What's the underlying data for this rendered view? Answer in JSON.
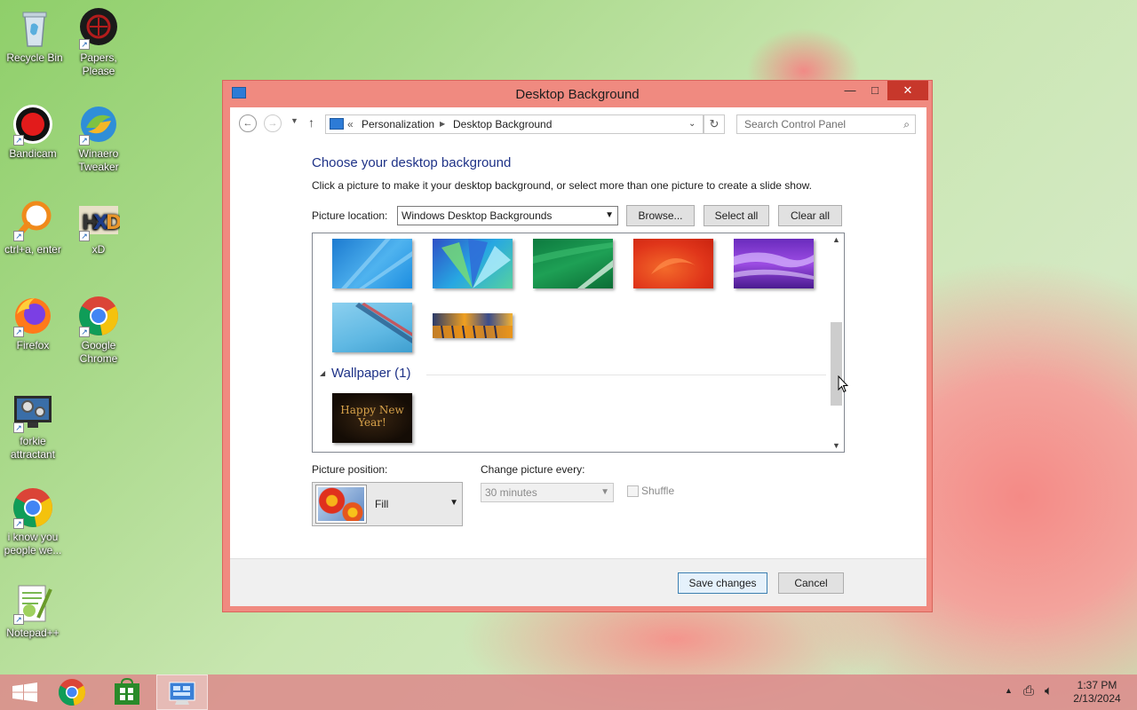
{
  "desktop": {
    "icons": [
      {
        "label": "Recycle Bin"
      },
      {
        "label": "Papers, Please"
      },
      {
        "label": "Bandicam"
      },
      {
        "label": "Winaero Tweaker"
      },
      {
        "label": "ctrl+a, enter"
      },
      {
        "label": "xD"
      },
      {
        "label": "Firefox"
      },
      {
        "label": "Google Chrome"
      },
      {
        "label": "forkie attractant"
      },
      {
        "label": "i know you people we..."
      },
      {
        "label": "Notepad++"
      }
    ]
  },
  "window": {
    "title": "Desktop Background",
    "minimize": "—",
    "maximize": "□",
    "close": "✕",
    "nav": {
      "breadcrumb_prefix": "«",
      "breadcrumb": [
        "Personalization",
        "Desktop Background"
      ],
      "search_placeholder": "Search Control Panel"
    },
    "heading": "Choose your desktop background",
    "subtext": "Click a picture to make it your desktop background, or select more than one picture to create a slide show.",
    "picture_location_label": "Picture location:",
    "picture_location_value": "Windows Desktop Backgrounds",
    "browse_button": "Browse...",
    "select_all_button": "Select all",
    "clear_all_button": "Clear all",
    "group_label": "Wallpaper (1)",
    "wallpaper_thumb_text": "Happy New Year!",
    "picture_position_label": "Picture position:",
    "picture_position_value": "Fill",
    "change_picture_label": "Change picture every:",
    "change_picture_value": "30 minutes",
    "shuffle_label": "Shuffle",
    "save_button": "Save changes",
    "cancel_button": "Cancel"
  },
  "taskbar": {
    "time": "1:37 PM",
    "date": "2/13/2024"
  }
}
